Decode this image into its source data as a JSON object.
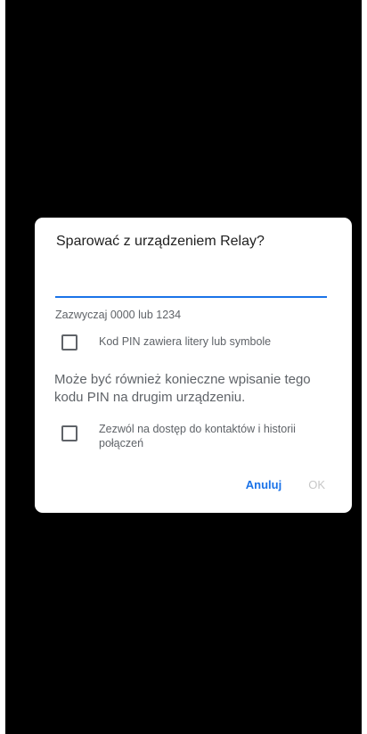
{
  "dialog": {
    "title": "Sparować z urządzeniem Relay?",
    "pin_value": "",
    "hint": "Zazwyczaj 0000 lub 1234",
    "checkbox_pin_letters": {
      "label": "Kod PIN zawiera litery lub symbole",
      "checked": false
    },
    "info": "Może być również konieczne wpisanie tego kodu PIN na drugim urządzeniu.",
    "checkbox_contacts": {
      "label": "Zezwól na dostęp do kontaktów i historii połączeń",
      "checked": false
    },
    "buttons": {
      "cancel": "Anuluj",
      "ok": "OK"
    }
  },
  "colors": {
    "accent": "#1a73e8",
    "disabled": "#c7c7c7",
    "background": "#000000"
  }
}
